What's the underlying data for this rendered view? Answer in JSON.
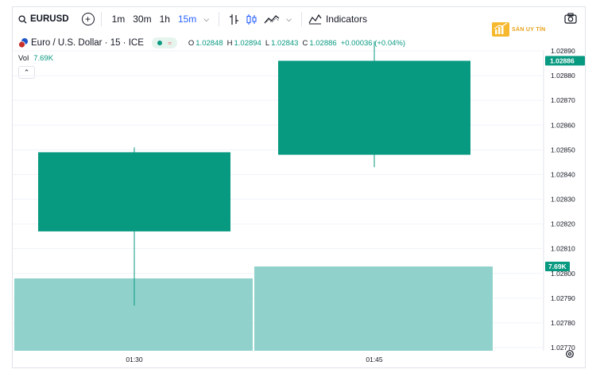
{
  "toolbar": {
    "symbol": "EURUSD",
    "intervals": [
      {
        "label": "1m",
        "active": false
      },
      {
        "label": "30m",
        "active": false
      },
      {
        "label": "1h",
        "active": false
      },
      {
        "label": "15m",
        "active": true
      }
    ],
    "indicators_label": "Indicators",
    "icons": [
      "search-icon",
      "add-symbol-icon",
      "chevron-down-icon",
      "bar-style-icon",
      "candle-style-icon",
      "compare-icon",
      "indicators-icon",
      "camera-icon"
    ]
  },
  "logo": {
    "text": "SÀN UY TÍN"
  },
  "legend": {
    "title": "Euro / U.S. Dollar · 15 · ICE",
    "open_key": "O",
    "open": "1.02848",
    "high_key": "H",
    "high": "1.02894",
    "low_key": "L",
    "low": "1.02843",
    "close_key": "C",
    "close": "1.02886",
    "change": "+0.00036 (+0.04%)",
    "vol_label": "Vol",
    "vol_value": "7.69K"
  },
  "colors": {
    "up": "#089981",
    "volume": "#90d2cb",
    "grid": "#f0f3fa",
    "accent": "#2962ff"
  },
  "price_axis": {
    "ticks": [
      "1.02890",
      "1.02880",
      "1.02870",
      "1.02860",
      "1.02850",
      "1.02840",
      "1.02830",
      "1.02820",
      "1.02810",
      "1.02800",
      "1.02790",
      "1.02780",
      "1.02770"
    ],
    "last_price_tag": "1.02886",
    "volume_tag": "7.69K"
  },
  "time_axis": {
    "ticks": [
      "01:30",
      "01:45"
    ]
  },
  "chart_data": {
    "type": "candlestick",
    "ylim": [
      1.0277,
      1.0289
    ],
    "candles": [
      {
        "time": "01:30",
        "open": 1.02817,
        "high": 1.02851,
        "low": 1.02787,
        "close": 1.02849,
        "volume": 6.6
      },
      {
        "time": "01:45",
        "open": 1.02848,
        "high": 1.02894,
        "low": 1.02843,
        "close": 1.02886,
        "volume": 7.69
      }
    ],
    "volume_unit": "K"
  }
}
